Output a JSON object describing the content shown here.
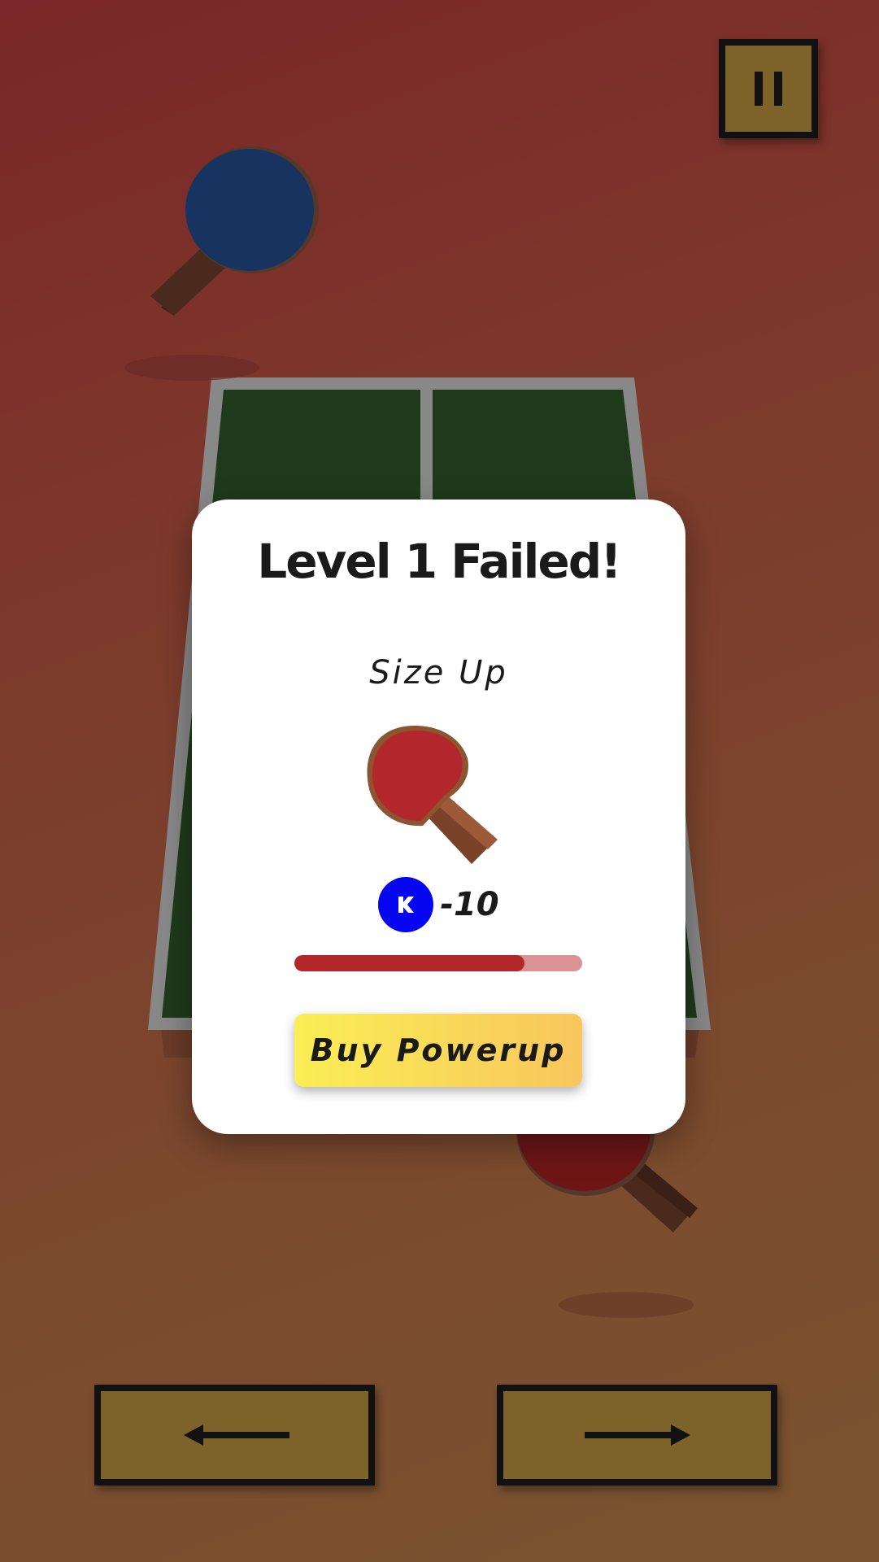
{
  "game": {
    "level_number": 1,
    "pause_icon": "pause-icon",
    "left_arrow_icon": "arrow-left-icon",
    "right_arrow_icon": "arrow-right-icon"
  },
  "modal": {
    "title": "Level 1 Failed!",
    "powerup_name": "Size Up",
    "powerup_icon": "paddle-icon",
    "coin_icon": "coin-icon",
    "cost": "-10",
    "progress_fraction": 0.8,
    "buy_label": "Buy Powerup"
  },
  "colors": {
    "player_paddle": "#b3262b",
    "opponent_paddle": "#173461",
    "table": "#1f3a1b",
    "coin": "#0505f0",
    "button": "#7d632a",
    "progress_fill": "#b3262b",
    "progress_track": "#da9292"
  }
}
